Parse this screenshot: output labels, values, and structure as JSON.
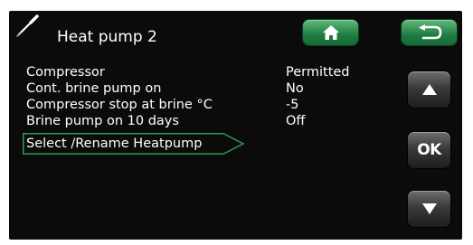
{
  "header": {
    "title": "Heat pump 2",
    "icon": "screwdriver-icon",
    "home_icon": "home-icon",
    "back_icon": "back-arrow-icon"
  },
  "rows": [
    {
      "label": "Compressor",
      "value": "Permitted"
    },
    {
      "label": "Cont. brine pump on",
      "value": "No"
    },
    {
      "label": "Compressor stop at brine °C",
      "value": "-5"
    },
    {
      "label": "Brine pump on 10 days",
      "value": "Off"
    }
  ],
  "selected_item": {
    "label": "Select /Rename Heatpump"
  },
  "nav": {
    "up_icon": "arrow-up-icon",
    "ok_label": "OK",
    "down_icon": "arrow-down-icon"
  },
  "colors": {
    "screen_bg": "#0b0b0b",
    "accent_green": "#1f7c42",
    "selection_outline": "#2e9a4e",
    "text": "#ffffff"
  }
}
